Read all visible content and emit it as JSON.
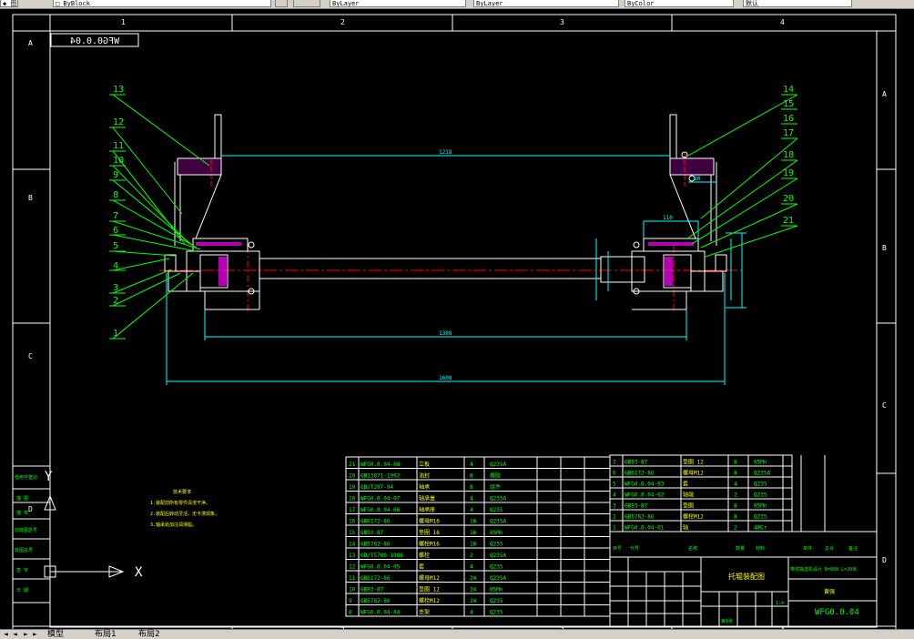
{
  "toolbar": {
    "layer_field": "□ ByBlock",
    "layer_field_left": "◆ 图层",
    "linetype_field": "ByLayer",
    "lineweight_field": "ByLayer",
    "color_field": "ByColor",
    "style_field": "默认"
  },
  "tabs": {
    "nav": [
      "◄",
      "◄",
      "►",
      "►"
    ],
    "model": "模型",
    "layout1": "布局1",
    "layout2": "布局2"
  },
  "frame": {
    "cols_top": [
      "1",
      "2",
      "3",
      "4"
    ],
    "cols_bottom": [
      "1",
      "2",
      "3",
      "4"
    ],
    "rows_left": [
      "A",
      "B",
      "C",
      "D"
    ],
    "rows_right": [
      "A",
      "B",
      "C",
      "D"
    ]
  },
  "drawing": {
    "mirrored_code": "WFG0.0.04",
    "balloons_left": [
      "13",
      "12",
      "11",
      "10",
      "9",
      "8",
      "7",
      "6",
      "5",
      "4",
      "3",
      "2",
      "1"
    ],
    "balloons_right": [
      "14",
      "15",
      "16",
      "17",
      "18",
      "19",
      "20",
      "21"
    ],
    "dims": {
      "top": "1218",
      "mid": "1308",
      "bottom": "1608",
      "right_small": "110",
      "right_60": "60"
    },
    "notes_title": "技术要求",
    "notes": [
      "1.装配前所有零件清洗干净。",
      "2.装配后转动灵活，无卡滞现象。",
      "3.轴承处加注润滑脂。"
    ]
  },
  "ucs": {
    "x_label": "X",
    "y_label": "Y"
  },
  "bom_left": [
    [
      "21",
      "WFG0.0.04-08",
      "立板",
      "4",
      "Q235A"
    ],
    [
      "20",
      "GB13871-1992",
      "油封",
      "8",
      "橡胶"
    ],
    [
      "19",
      "GB/T297-94",
      "轴承",
      "8",
      "组件"
    ],
    [
      "18",
      "WFG0.0.04-07",
      "轴承盖",
      "4",
      "Q235A"
    ],
    [
      "17",
      "WFG0.0.04-06",
      "轴承座",
      "4",
      "Q235"
    ],
    [
      "16",
      "GB6172-86",
      "螺母M16",
      "16",
      "Q235A"
    ],
    [
      "15",
      "GB93-87",
      "垫圈 16",
      "16",
      "65Mn"
    ],
    [
      "14",
      "GB5782-86",
      "螺栓M16",
      "16",
      "Q235"
    ],
    [
      "13",
      "GB/T5780-1986",
      "螺栓",
      "2",
      "Q235A"
    ],
    [
      "12",
      "WFG0.0.04-05",
      "套",
      "4",
      "Q235"
    ],
    [
      "11",
      "GB6172-86",
      "螺母M12",
      "24",
      "Q235A"
    ],
    [
      "10",
      "GB93-87",
      "垫圈 12",
      "24",
      "65Mn"
    ],
    [
      "9",
      "GB5782-86",
      "螺栓M12",
      "24",
      "Q235"
    ],
    [
      "8",
      "WFG0.0.04-04",
      "支架",
      "4",
      "Q235"
    ]
  ],
  "bom_right": [
    [
      "7",
      "GB93-87",
      "垫圈 12",
      "8",
      "65Mn"
    ],
    [
      "6",
      "GB6172-86",
      "螺母M12",
      "8",
      "Q235A"
    ],
    [
      "5",
      "WFG0.0.04-03",
      "套",
      "4",
      "Q235"
    ],
    [
      "4",
      "WFG0.0.04-02",
      "轴端",
      "2",
      "Q235"
    ],
    [
      "3",
      "GB93-87",
      "垫圈",
      "8",
      "65Mn"
    ],
    [
      "2",
      "GB5782-86",
      "螺栓M12",
      "8",
      "Q235"
    ],
    [
      "1",
      "WFG0.0.04-01",
      "轴",
      "2",
      "40Cr"
    ]
  ],
  "bom_header": [
    "序号",
    "代号",
    "名称",
    "数量",
    "材料",
    "单件",
    "总计",
    "备注"
  ],
  "title_block": {
    "name": "托辊装配图",
    "project": "带式输送机设计 B=800 L=20米",
    "company": "黄强",
    "drawing_no": "WFG0.0.04",
    "scale": "1:4",
    "sheet": "第1张"
  },
  "side_table": [
    "借用件登记",
    "描 图",
    "描 校",
    "旧底图总号",
    "底图总号",
    "签 字",
    "日 期"
  ],
  "colors": {
    "line": "#00ff00",
    "white": "#ffffff",
    "cyan": "#00ffff",
    "red": "#ff0000",
    "yellow": "#ffff00",
    "magenta": "#ff00ff"
  }
}
